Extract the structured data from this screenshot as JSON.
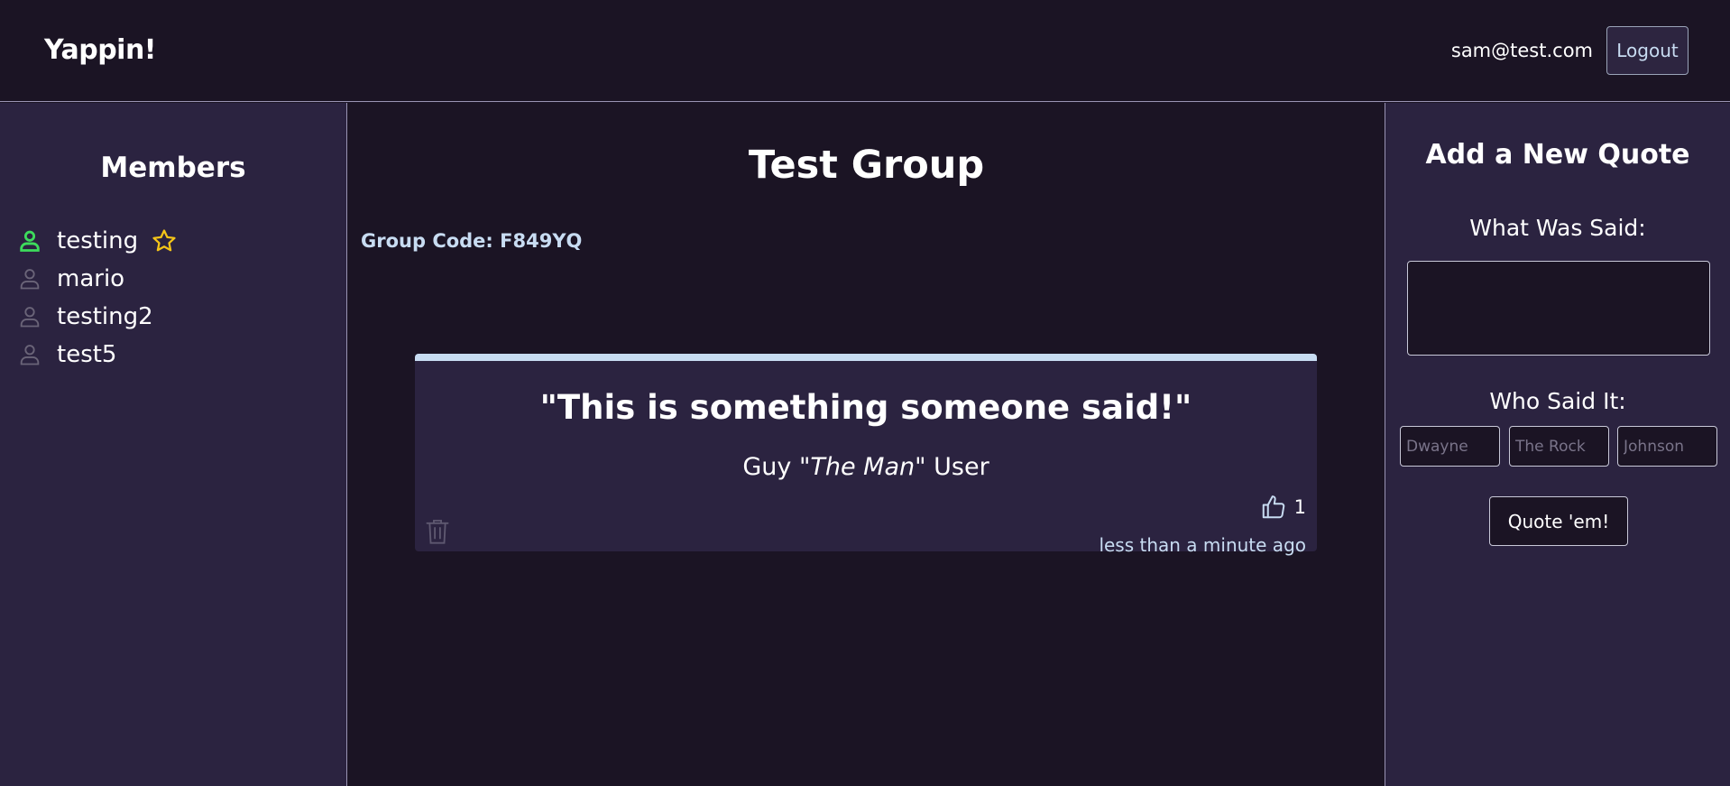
{
  "header": {
    "brand": "Yappin!",
    "user_email": "sam@test.com",
    "logout_label": "Logout"
  },
  "members": {
    "title": "Members",
    "items": [
      {
        "name": "testing",
        "icon": "person-icon",
        "online": true,
        "owner": true
      },
      {
        "name": "mario",
        "icon": "person-icon",
        "online": false,
        "owner": false
      },
      {
        "name": "testing2",
        "icon": "person-icon",
        "online": false,
        "owner": false
      },
      {
        "name": "test5",
        "icon": "person-icon",
        "online": false,
        "owner": false
      }
    ]
  },
  "group": {
    "title": "Test Group",
    "code_text": "Group Code: F849YQ"
  },
  "quotes": [
    {
      "text": "\"This is something someone said!\"",
      "author_first": "Guy",
      "author_nickname": "\"The Man\"",
      "author_last": "User",
      "likes": "1",
      "timestamp": "less than a minute ago",
      "like_icon": "thumbs-up-icon",
      "delete_icon": "trash-icon"
    }
  ],
  "add_quote": {
    "title": "Add a New Quote",
    "said_label": "What Was Said:",
    "said_value": "",
    "who_label": "Who Said It:",
    "first_placeholder": "Dwayne",
    "nick_placeholder": "The Rock",
    "last_placeholder": "Johnson",
    "submit_label": "Quote 'em!"
  },
  "colors": {
    "background": "#1b1424",
    "panel": "#2b2340",
    "accent": "#c8dcf2",
    "online": "#3ddc5c",
    "offline": "#6a6478",
    "star": "#f5c518"
  }
}
